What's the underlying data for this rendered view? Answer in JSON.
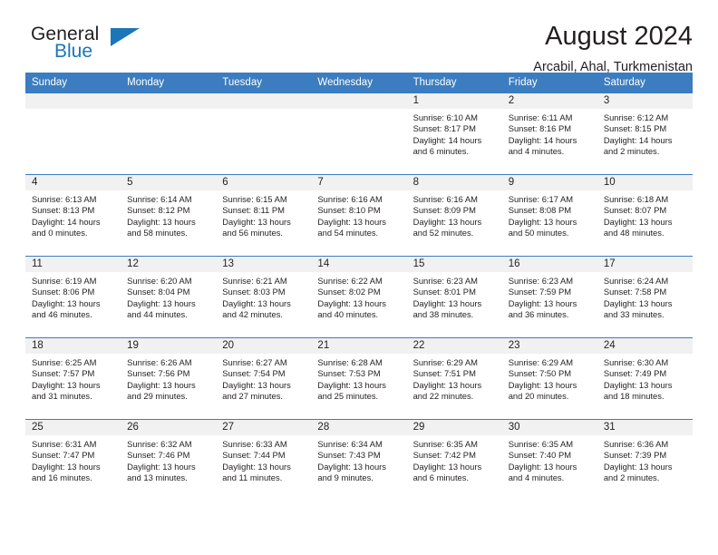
{
  "brand": {
    "name_part1": "General",
    "name_part2": "Blue",
    "triangle_icon": "triangle-icon",
    "accent_color": "#1b75bb"
  },
  "header": {
    "title": "August 2024",
    "subtitle": "Arcabil, Ahal, Turkmenistan"
  },
  "theme": {
    "header_blue": "#3b7dc0",
    "daynum_band": "#f1f1f1",
    "text": "#231f20"
  },
  "weekday_headers": [
    "Sunday",
    "Monday",
    "Tuesday",
    "Wednesday",
    "Thursday",
    "Friday",
    "Saturday"
  ],
  "weeks": [
    [
      {
        "day": "",
        "blank": true
      },
      {
        "day": "",
        "blank": true
      },
      {
        "day": "",
        "blank": true
      },
      {
        "day": "",
        "blank": true
      },
      {
        "day": "1",
        "sunrise": "Sunrise: 6:10 AM",
        "sunset": "Sunset: 8:17 PM",
        "daylight_line1": "Daylight: 14 hours",
        "daylight_line2": "and 6 minutes."
      },
      {
        "day": "2",
        "sunrise": "Sunrise: 6:11 AM",
        "sunset": "Sunset: 8:16 PM",
        "daylight_line1": "Daylight: 14 hours",
        "daylight_line2": "and 4 minutes."
      },
      {
        "day": "3",
        "sunrise": "Sunrise: 6:12 AM",
        "sunset": "Sunset: 8:15 PM",
        "daylight_line1": "Daylight: 14 hours",
        "daylight_line2": "and 2 minutes."
      }
    ],
    [
      {
        "day": "4",
        "sunrise": "Sunrise: 6:13 AM",
        "sunset": "Sunset: 8:13 PM",
        "daylight_line1": "Daylight: 14 hours",
        "daylight_line2": "and 0 minutes."
      },
      {
        "day": "5",
        "sunrise": "Sunrise: 6:14 AM",
        "sunset": "Sunset: 8:12 PM",
        "daylight_line1": "Daylight: 13 hours",
        "daylight_line2": "and 58 minutes."
      },
      {
        "day": "6",
        "sunrise": "Sunrise: 6:15 AM",
        "sunset": "Sunset: 8:11 PM",
        "daylight_line1": "Daylight: 13 hours",
        "daylight_line2": "and 56 minutes."
      },
      {
        "day": "7",
        "sunrise": "Sunrise: 6:16 AM",
        "sunset": "Sunset: 8:10 PM",
        "daylight_line1": "Daylight: 13 hours",
        "daylight_line2": "and 54 minutes."
      },
      {
        "day": "8",
        "sunrise": "Sunrise: 6:16 AM",
        "sunset": "Sunset: 8:09 PM",
        "daylight_line1": "Daylight: 13 hours",
        "daylight_line2": "and 52 minutes."
      },
      {
        "day": "9",
        "sunrise": "Sunrise: 6:17 AM",
        "sunset": "Sunset: 8:08 PM",
        "daylight_line1": "Daylight: 13 hours",
        "daylight_line2": "and 50 minutes."
      },
      {
        "day": "10",
        "sunrise": "Sunrise: 6:18 AM",
        "sunset": "Sunset: 8:07 PM",
        "daylight_line1": "Daylight: 13 hours",
        "daylight_line2": "and 48 minutes."
      }
    ],
    [
      {
        "day": "11",
        "sunrise": "Sunrise: 6:19 AM",
        "sunset": "Sunset: 8:06 PM",
        "daylight_line1": "Daylight: 13 hours",
        "daylight_line2": "and 46 minutes."
      },
      {
        "day": "12",
        "sunrise": "Sunrise: 6:20 AM",
        "sunset": "Sunset: 8:04 PM",
        "daylight_line1": "Daylight: 13 hours",
        "daylight_line2": "and 44 minutes."
      },
      {
        "day": "13",
        "sunrise": "Sunrise: 6:21 AM",
        "sunset": "Sunset: 8:03 PM",
        "daylight_line1": "Daylight: 13 hours",
        "daylight_line2": "and 42 minutes."
      },
      {
        "day": "14",
        "sunrise": "Sunrise: 6:22 AM",
        "sunset": "Sunset: 8:02 PM",
        "daylight_line1": "Daylight: 13 hours",
        "daylight_line2": "and 40 minutes."
      },
      {
        "day": "15",
        "sunrise": "Sunrise: 6:23 AM",
        "sunset": "Sunset: 8:01 PM",
        "daylight_line1": "Daylight: 13 hours",
        "daylight_line2": "and 38 minutes."
      },
      {
        "day": "16",
        "sunrise": "Sunrise: 6:23 AM",
        "sunset": "Sunset: 7:59 PM",
        "daylight_line1": "Daylight: 13 hours",
        "daylight_line2": "and 36 minutes."
      },
      {
        "day": "17",
        "sunrise": "Sunrise: 6:24 AM",
        "sunset": "Sunset: 7:58 PM",
        "daylight_line1": "Daylight: 13 hours",
        "daylight_line2": "and 33 minutes."
      }
    ],
    [
      {
        "day": "18",
        "sunrise": "Sunrise: 6:25 AM",
        "sunset": "Sunset: 7:57 PM",
        "daylight_line1": "Daylight: 13 hours",
        "daylight_line2": "and 31 minutes."
      },
      {
        "day": "19",
        "sunrise": "Sunrise: 6:26 AM",
        "sunset": "Sunset: 7:56 PM",
        "daylight_line1": "Daylight: 13 hours",
        "daylight_line2": "and 29 minutes."
      },
      {
        "day": "20",
        "sunrise": "Sunrise: 6:27 AM",
        "sunset": "Sunset: 7:54 PM",
        "daylight_line1": "Daylight: 13 hours",
        "daylight_line2": "and 27 minutes."
      },
      {
        "day": "21",
        "sunrise": "Sunrise: 6:28 AM",
        "sunset": "Sunset: 7:53 PM",
        "daylight_line1": "Daylight: 13 hours",
        "daylight_line2": "and 25 minutes."
      },
      {
        "day": "22",
        "sunrise": "Sunrise: 6:29 AM",
        "sunset": "Sunset: 7:51 PM",
        "daylight_line1": "Daylight: 13 hours",
        "daylight_line2": "and 22 minutes."
      },
      {
        "day": "23",
        "sunrise": "Sunrise: 6:29 AM",
        "sunset": "Sunset: 7:50 PM",
        "daylight_line1": "Daylight: 13 hours",
        "daylight_line2": "and 20 minutes."
      },
      {
        "day": "24",
        "sunrise": "Sunrise: 6:30 AM",
        "sunset": "Sunset: 7:49 PM",
        "daylight_line1": "Daylight: 13 hours",
        "daylight_line2": "and 18 minutes."
      }
    ],
    [
      {
        "day": "25",
        "sunrise": "Sunrise: 6:31 AM",
        "sunset": "Sunset: 7:47 PM",
        "daylight_line1": "Daylight: 13 hours",
        "daylight_line2": "and 16 minutes."
      },
      {
        "day": "26",
        "sunrise": "Sunrise: 6:32 AM",
        "sunset": "Sunset: 7:46 PM",
        "daylight_line1": "Daylight: 13 hours",
        "daylight_line2": "and 13 minutes."
      },
      {
        "day": "27",
        "sunrise": "Sunrise: 6:33 AM",
        "sunset": "Sunset: 7:44 PM",
        "daylight_line1": "Daylight: 13 hours",
        "daylight_line2": "and 11 minutes."
      },
      {
        "day": "28",
        "sunrise": "Sunrise: 6:34 AM",
        "sunset": "Sunset: 7:43 PM",
        "daylight_line1": "Daylight: 13 hours",
        "daylight_line2": "and 9 minutes."
      },
      {
        "day": "29",
        "sunrise": "Sunrise: 6:35 AM",
        "sunset": "Sunset: 7:42 PM",
        "daylight_line1": "Daylight: 13 hours",
        "daylight_line2": "and 6 minutes."
      },
      {
        "day": "30",
        "sunrise": "Sunrise: 6:35 AM",
        "sunset": "Sunset: 7:40 PM",
        "daylight_line1": "Daylight: 13 hours",
        "daylight_line2": "and 4 minutes."
      },
      {
        "day": "31",
        "sunrise": "Sunrise: 6:36 AM",
        "sunset": "Sunset: 7:39 PM",
        "daylight_line1": "Daylight: 13 hours",
        "daylight_line2": "and 2 minutes."
      }
    ]
  ]
}
